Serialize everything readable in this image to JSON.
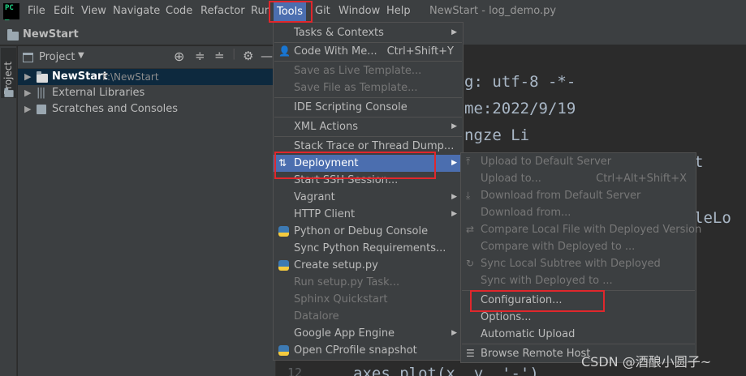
{
  "menubar": {
    "items": [
      "File",
      "Edit",
      "View",
      "Navigate",
      "Code",
      "Refactor",
      "Run",
      "Tools",
      "Git",
      "Window",
      "Help"
    ],
    "window_title": "NewStart - log_demo.py"
  },
  "navbar": {
    "breadcrumb": "NewStart"
  },
  "left_stripe": {
    "tab": "Project"
  },
  "project_panel": {
    "title": "Project",
    "tree": [
      {
        "label": "NewStart",
        "path": "F:\\NewStart"
      },
      {
        "label": "External Libraries"
      },
      {
        "label": "Scratches and Consoles"
      }
    ]
  },
  "editor": {
    "lines": [
      "g: utf-8 -*-",
      "me:2022/9/19",
      "ngze Li",
      "t",
      "leLo"
    ],
    "bottom_line_number": "12",
    "bottom_code": "axes.plot(x, y, '-')"
  },
  "tools_menu": {
    "items": [
      {
        "label": "Tasks & Contexts",
        "submenu": true
      },
      {
        "label": "Code With Me...",
        "shortcut": "Ctrl+Shift+Y"
      },
      {
        "label": "Save as Live Template...",
        "disabled": true
      },
      {
        "label": "Save File as Template...",
        "disabled": true
      },
      {
        "label": "IDE Scripting Console"
      },
      {
        "label": "XML Actions",
        "submenu": true
      },
      {
        "label": "Stack Trace or Thread Dump..."
      },
      {
        "label": "Deployment",
        "submenu": true,
        "highlighted": true
      },
      {
        "label": "Start SSH Session..."
      },
      {
        "label": "Vagrant",
        "submenu": true
      },
      {
        "label": "HTTP Client",
        "submenu": true
      },
      {
        "label": "Python or Debug Console"
      },
      {
        "label": "Sync Python Requirements..."
      },
      {
        "label": "Create setup.py"
      },
      {
        "label": "Run setup.py Task...",
        "disabled": true
      },
      {
        "label": "Sphinx Quickstart",
        "disabled": true
      },
      {
        "label": "Datalore",
        "submenu": true,
        "disabled": true
      },
      {
        "label": "Google App Engine",
        "submenu": true
      },
      {
        "label": "Open CProfile snapshot"
      }
    ]
  },
  "deployment_submenu": {
    "items": [
      {
        "label": "Upload to Default Server",
        "disabled": true
      },
      {
        "label": "Upload to...",
        "shortcut": "Ctrl+Alt+Shift+X",
        "disabled": true
      },
      {
        "label": "Download from Default Server",
        "disabled": true
      },
      {
        "label": "Download from...",
        "disabled": true
      },
      {
        "label": "Compare Local File with Deployed Version",
        "disabled": true
      },
      {
        "label": "Compare with Deployed to ...",
        "disabled": true
      },
      {
        "label": "Sync Local Subtree with Deployed",
        "disabled": true
      },
      {
        "label": "Sync with Deployed to ...",
        "disabled": true
      },
      {
        "label": "Configuration..."
      },
      {
        "label": "Options..."
      },
      {
        "label": "Automatic Upload"
      },
      {
        "label": "Browse Remote Host"
      }
    ]
  },
  "watermark": "CSDN @酒酿小圆子~",
  "colors": {
    "accent": "#4b6eaf",
    "annotation": "#e0272c",
    "selection": "#0d293e"
  }
}
